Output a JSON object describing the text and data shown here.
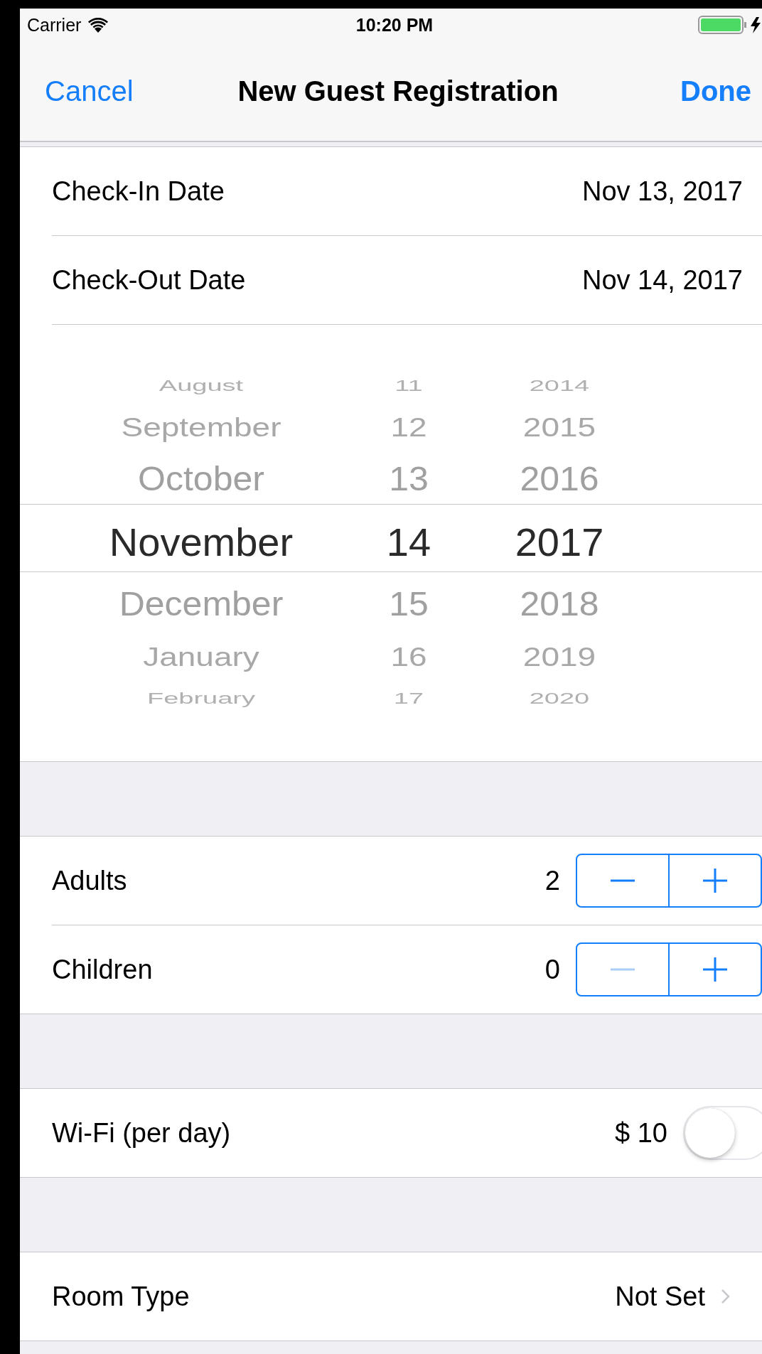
{
  "status_bar": {
    "carrier": "Carrier",
    "time": "10:20 PM"
  },
  "nav": {
    "cancel": "Cancel",
    "title": "New Guest Registration",
    "done": "Done"
  },
  "dates": [
    {
      "label": "Check-In Date",
      "value": "Nov 13, 2017"
    },
    {
      "label": "Check-Out Date",
      "value": "Nov 14, 2017"
    }
  ],
  "date_picker": {
    "rows": [
      {
        "month": "August",
        "day": "11",
        "year": "2014",
        "selected": false
      },
      {
        "month": "September",
        "day": "12",
        "year": "2015",
        "selected": false
      },
      {
        "month": "October",
        "day": "13",
        "year": "2016",
        "selected": false
      },
      {
        "month": "November",
        "day": "14",
        "year": "2017",
        "selected": true
      },
      {
        "month": "December",
        "day": "15",
        "year": "2018",
        "selected": false
      },
      {
        "month": "January",
        "day": "16",
        "year": "2019",
        "selected": false
      },
      {
        "month": "February",
        "day": "17",
        "year": "2020",
        "selected": false
      }
    ]
  },
  "guests": [
    {
      "label": "Adults",
      "value": "2",
      "decrement_disabled": false
    },
    {
      "label": "Children",
      "value": "0",
      "decrement_disabled": true
    }
  ],
  "wifi": {
    "label": "Wi-Fi (per day)",
    "price": "$ 10",
    "on": false
  },
  "room_type": {
    "label": "Room Type",
    "value": "Not Set"
  }
}
